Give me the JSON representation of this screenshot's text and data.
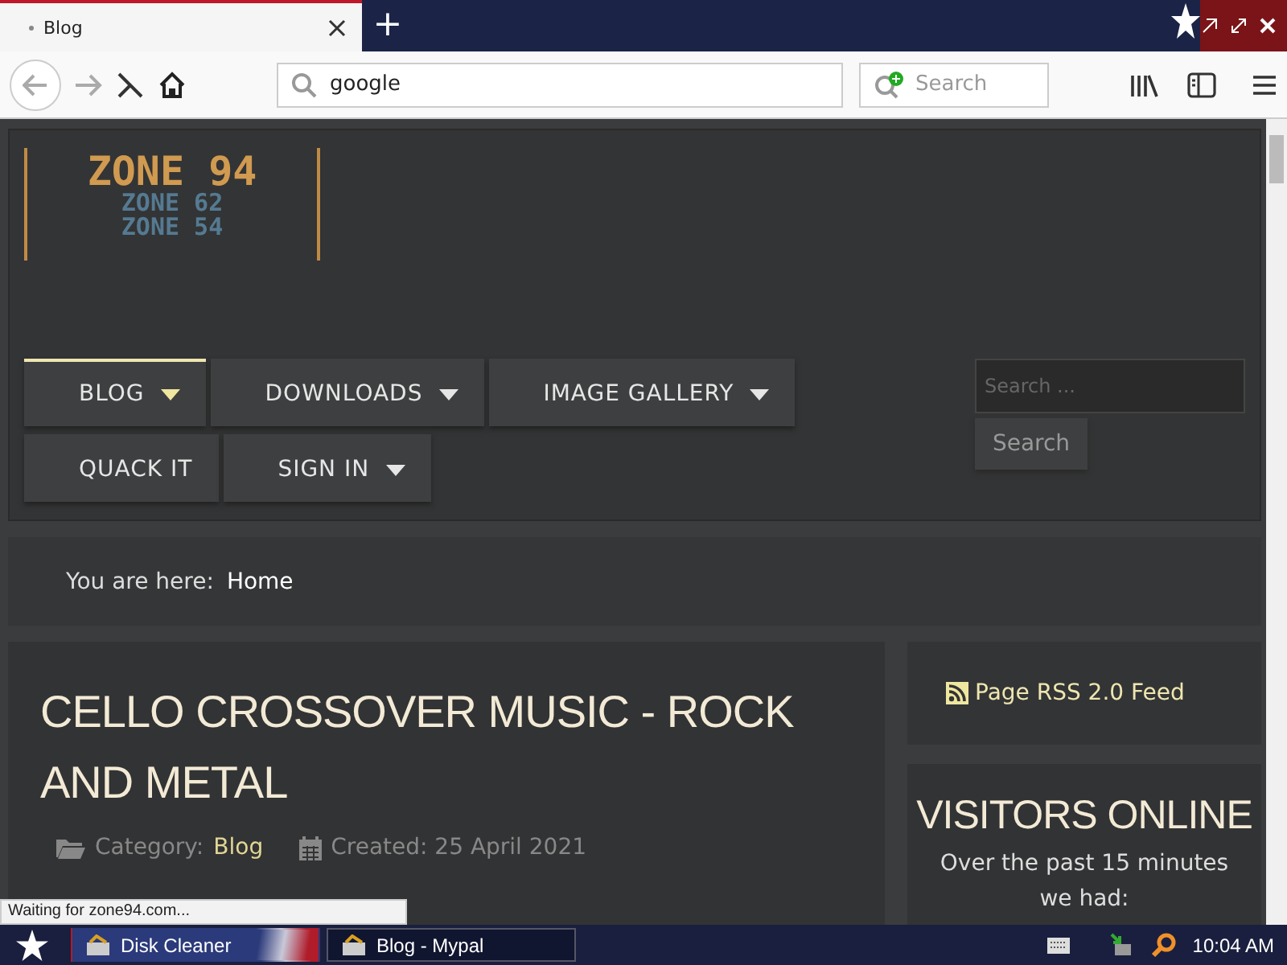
{
  "browser": {
    "tab": {
      "title": "Blog"
    },
    "new_tab": "+",
    "address": "google",
    "search": {
      "placeholder": "Search"
    }
  },
  "site": {
    "logo": {
      "main": "ZONE 94",
      "sub": [
        "ZONE 62",
        "ZONE 54"
      ]
    },
    "menu": [
      {
        "label": "BLOG",
        "selected": true,
        "has_dropdown": true
      },
      {
        "label": "DOWNLOADS",
        "selected": false,
        "has_dropdown": true
      },
      {
        "label": "IMAGE GALLERY",
        "selected": false,
        "has_dropdown": true
      },
      {
        "label": "QUACK IT",
        "selected": false,
        "has_dropdown": false
      },
      {
        "label": "SIGN IN",
        "selected": false,
        "has_dropdown": true
      }
    ],
    "search": {
      "placeholder": "Search ...",
      "button": "Search"
    },
    "breadcrumb": {
      "label": "You are here:",
      "current": "Home"
    },
    "article": {
      "title": "CELLO CROSSOVER MUSIC - ROCK AND METAL",
      "category_label": "Category:",
      "category": "Blog",
      "created": "Created: 25 April 2021"
    },
    "rss": {
      "label": "Page RSS 2.0 Feed"
    },
    "visitors": {
      "title": "VISITORS ONLINE",
      "text": "Over the past 15 minutes we had:"
    }
  },
  "status": "Waiting for zone94.com...",
  "taskbar": {
    "items": [
      {
        "label": "Disk Cleaner",
        "selected": false
      },
      {
        "label": "Blog - Mypal",
        "selected": true
      }
    ],
    "clock": "10:04 AM"
  }
}
